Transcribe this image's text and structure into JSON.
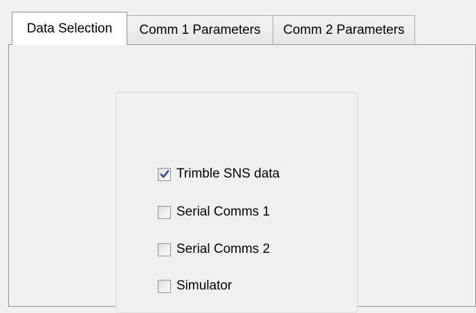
{
  "tabs": [
    {
      "label": "Data Selection",
      "selected": true
    },
    {
      "label": "Comm 1 Parameters",
      "selected": false
    },
    {
      "label": "Comm 2 Parameters",
      "selected": false
    }
  ],
  "data_selection": {
    "options": [
      {
        "label": "Trimble SNS data",
        "checked": true
      },
      {
        "label": "Serial Comms 1",
        "checked": false
      },
      {
        "label": "Serial Comms 2",
        "checked": false
      },
      {
        "label": "Simulator",
        "checked": false
      }
    ]
  },
  "colors": {
    "check_mark": "#2a4a86",
    "window_background": "#f0f0f0",
    "active_tab_background": "#ffffff"
  }
}
